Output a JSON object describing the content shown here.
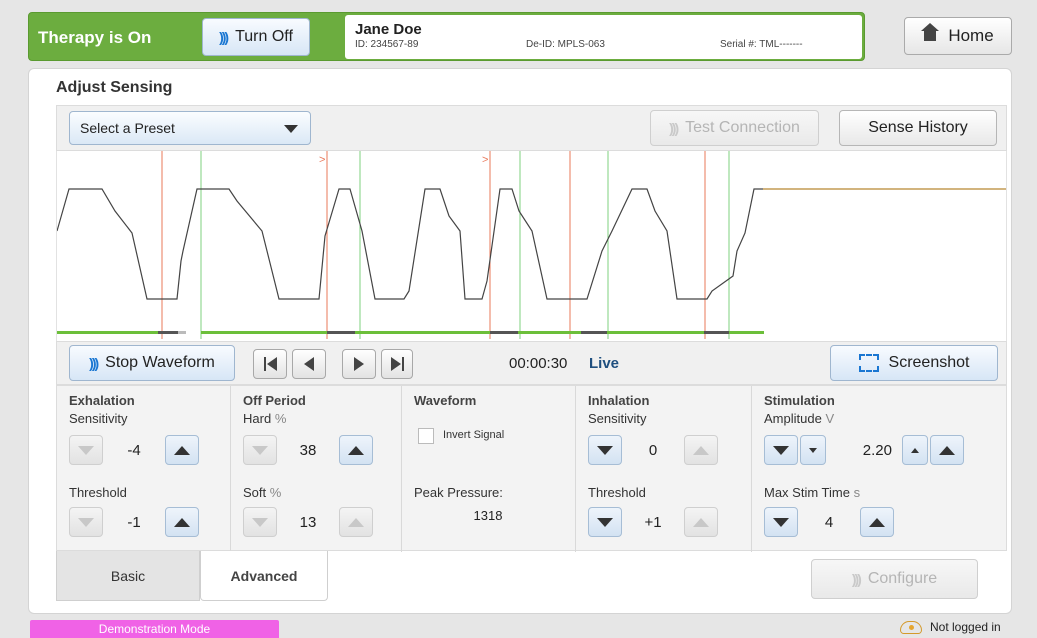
{
  "header": {
    "therapy_status": "Therapy is On",
    "turn_off_label": "Turn Off",
    "patient_name": "Jane Doe",
    "patient_id": "ID: 234567-89",
    "deid": "De-ID: MPLS-063",
    "serial": "Serial #: TML-------",
    "home_label": "Home"
  },
  "page": {
    "title": "Adjust Sensing",
    "preset_placeholder": "Select a Preset",
    "test_connection_label": "Test Connection",
    "sense_history_label": "Sense History"
  },
  "controls": {
    "stop_waveform_label": "Stop Waveform",
    "time": "00:00:30",
    "live_label": "Live",
    "screenshot_label": "Screenshot"
  },
  "exhalation": {
    "title": "Exhalation",
    "sensitivity_label": "Sensitivity",
    "sensitivity_value": "-4",
    "threshold_label": "Threshold",
    "threshold_value": "-1"
  },
  "off_period": {
    "title": "Off Period",
    "hard_label": "Hard",
    "hard_unit": "%",
    "hard_value": "38",
    "soft_label": "Soft",
    "soft_unit": "%",
    "soft_value": "13"
  },
  "waveform": {
    "title": "Waveform",
    "invert_label": "Invert Signal",
    "invert_checked": false,
    "peak_label": "Peak Pressure:",
    "peak_value": "1318"
  },
  "inhalation": {
    "title": "Inhalation",
    "sensitivity_label": "Sensitivity",
    "sensitivity_value": "0",
    "threshold_label": "Threshold",
    "threshold_value": "+1"
  },
  "stimulation": {
    "title": "Stimulation",
    "amplitude_label": "Amplitude",
    "amplitude_unit": "V",
    "amplitude_value": "2.20",
    "max_stim_label": "Max Stim Time",
    "max_stim_unit": "s",
    "max_stim_value": "4"
  },
  "tabs": {
    "basic_label": "Basic",
    "advanced_label": "Advanced",
    "active": "Advanced"
  },
  "configure_label": "Configure",
  "footer": {
    "demo_mode_label": "Demonstration Mode",
    "login_status": "Not logged in"
  },
  "colors": {
    "therapy_green": "#6cad3f",
    "accent_blue": "#1976d2",
    "demo_pink": "#f062e6",
    "waveform_line": "#444444",
    "exhalation_marker": "#e8785a",
    "inhalation_marker": "#7fd07f",
    "sensing_bar": "#6cbf3a"
  }
}
